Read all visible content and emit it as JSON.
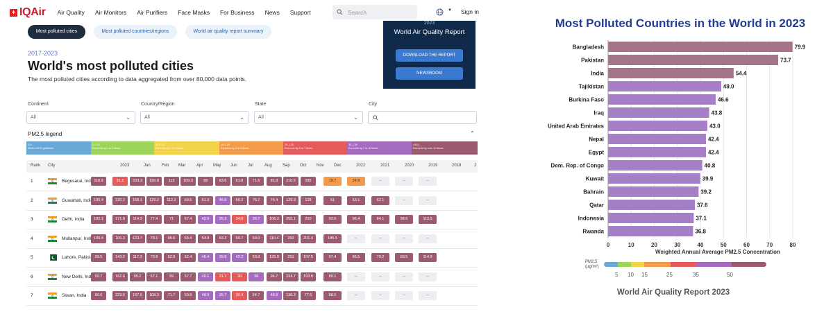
{
  "nav": {
    "logo": "IQAir",
    "links": [
      "Air Quality",
      "Air Monitors",
      "Air Purifiers",
      "Face Masks",
      "For Business",
      "News",
      "Support"
    ],
    "search_placeholder": "Search",
    "signin": "Sign in"
  },
  "tabs": [
    "Most polluted cities",
    "Most polluted countries/regions",
    "World air quality report summary"
  ],
  "header": {
    "years": "2017-2023",
    "title": "World's most polluted cities",
    "subtitle": "The most polluted cities according to data aggregated from over 80,000 data points."
  },
  "report_card": {
    "year": "2023",
    "title": "World Air Quality Report",
    "download": "DOWNLOAD THE REPORT",
    "newsroom": "NEWSROOM"
  },
  "filters": [
    {
      "label": "Continent",
      "value": "All"
    },
    {
      "label": "Country/Region",
      "value": "All"
    },
    {
      "label": "State",
      "value": "All"
    },
    {
      "label": "City",
      "value": ""
    }
  ],
  "legend": {
    "title": "PM2.5 legend",
    "segments": [
      {
        "range": "0-5",
        "desc": "Meets WHO guideline",
        "color": "#6aa8d8"
      },
      {
        "range": "5.1-10",
        "desc": "Exceeds by 1 to 2 times",
        "color": "#9dd45b"
      },
      {
        "range": "10.1-15",
        "desc": "Exceeds by 2 to 3 times",
        "color": "#f3d34a"
      },
      {
        "range": "15.1-25",
        "desc": "Exceeds by 3 to 5 times",
        "color": "#f39b4b"
      },
      {
        "range": "25.1-35",
        "desc": "Exceeds by 5 to 7 times",
        "color": "#e55a5a"
      },
      {
        "range": "35.1-50",
        "desc": "Exceeds by 7 to 10 times",
        "color": "#a56bbf"
      },
      {
        "range": ">50.1",
        "desc": "Exceeds by over 10 times",
        "color": "#9c5a6e"
      }
    ]
  },
  "table": {
    "headers": [
      "Rank",
      "City",
      "2023",
      "Jan",
      "Feb",
      "Mar",
      "Apr",
      "May",
      "Jun",
      "Jul",
      "Aug",
      "Sep",
      "Oct",
      "Nov",
      "Dec",
      "2022",
      "2021",
      "2020",
      "2019",
      "2018",
      "2"
    ],
    "rows": [
      {
        "rank": "1",
        "city": "Begusarai, India",
        "country": "india",
        "vals": [
          "118.9",
          "31.2",
          "233.3",
          "156.8",
          "113",
          "109.3",
          "99",
          "63.6",
          "61.8",
          "71.5",
          "81.8",
          "210.5",
          "285",
          "19.7",
          "24.9",
          "--",
          "--",
          "--"
        ]
      },
      {
        "rank": "2",
        "city": "Guwahati, India",
        "country": "india",
        "vals": [
          "105.4",
          "220.2",
          "168.1",
          "129.2",
          "112.2",
          "69.5",
          "51.3",
          "46.6",
          "60.2",
          "76.7",
          "76.4",
          "129.9",
          "128",
          "51",
          "53.1",
          "62.1",
          "--",
          "--"
        ]
      },
      {
        "rank": "3",
        "city": "Delhi, India",
        "country": "india",
        "vals": [
          "102.1",
          "171.8",
          "114.3",
          "77.4",
          "71",
          "67.4",
          "42.9",
          "35.3",
          "34.8",
          "39.7",
          "106.3",
          "255.1",
          "210",
          "92.6",
          "96.4",
          "84.1",
          "98.6",
          "113.5"
        ]
      },
      {
        "rank": "4",
        "city": "Mullanpur, India",
        "country": "india",
        "vals": [
          "100.4",
          "106.3",
          "123.7",
          "78.1",
          "96.6",
          "53.4",
          "53.9",
          "63.2",
          "59.7",
          "59.6",
          "110.4",
          "253",
          "201.4",
          "185.5",
          "--",
          "--",
          "--",
          "--"
        ]
      },
      {
        "rank": "5",
        "city": "Lahore, Pakistan",
        "country": "pakistan",
        "vals": [
          "99.5",
          "143.2",
          "117.3",
          "73.8",
          "52.9",
          "52.4",
          "46.4",
          "39.8",
          "42.2",
          "53.8",
          "125.9",
          "251",
          "197.5",
          "97.4",
          "86.5",
          "79.2",
          "89.5",
          "114.9"
        ]
      },
      {
        "rank": "6",
        "city": "New Delhi, India",
        "country": "india",
        "vals": [
          "92.7",
          "162.6",
          "95.2",
          "67.1",
          "59",
          "57.7",
          "40.1",
          "31.7",
          "30",
          "38",
          "94.7",
          "234.7",
          "193.8",
          "89.1",
          "--",
          "--",
          "--",
          "--"
        ]
      },
      {
        "rank": "7",
        "city": "Siwan, India",
        "country": "india",
        "vals": [
          "90.6",
          "223.6",
          "167.5",
          "108.3",
          "71.7",
          "59.8",
          "48.9",
          "35.7",
          "30.4",
          "54.7",
          "48.9",
          "136.3",
          "77.6",
          "58.5",
          "--",
          "--",
          "--",
          "--"
        ]
      }
    ]
  },
  "right_panel": {
    "footer": "World Air Quality Report 2023",
    "pm_label_1": "PM2.5",
    "pm_label_2": "(µg/m³)",
    "scale_ticks": [
      "5",
      "10",
      "15",
      "25",
      "35",
      "50"
    ]
  },
  "chart_data": {
    "type": "bar",
    "orientation": "horizontal",
    "title": "Most Polluted Countries in the World in 2023",
    "xlabel": "Weighted Annual Average PM2.5 Concentration",
    "xlim": [
      0,
      80
    ],
    "xticks": [
      0,
      10,
      20,
      30,
      40,
      50,
      60,
      70,
      80
    ],
    "categories": [
      "Bangladesh",
      "Pakistan",
      "India",
      "Tajikistan",
      "Burkina Faso",
      "Iraq",
      "United Arab Emirates",
      "Nepal",
      "Egypt",
      "Dem. Rep. of Congo",
      "Kuwait",
      "Bahrain",
      "Qatar",
      "Indonesia",
      "Rwanda"
    ],
    "values": [
      79.9,
      73.7,
      54.4,
      49.0,
      46.6,
      43.8,
      43.0,
      42.4,
      42.4,
      40.8,
      39.9,
      39.2,
      37.6,
      37.1,
      36.8
    ],
    "value_labels": [
      "79.9",
      "73.7",
      "54.4",
      "49.0",
      "46.6",
      "43.8",
      "43.0",
      "42.4",
      "42.4",
      "40.8",
      "39.9",
      "39.2",
      "37.6",
      "37.1",
      "36.8"
    ],
    "colors": {
      "over_50": "#a4758a",
      "35_to_50": "#a580c7"
    },
    "grid": true
  }
}
